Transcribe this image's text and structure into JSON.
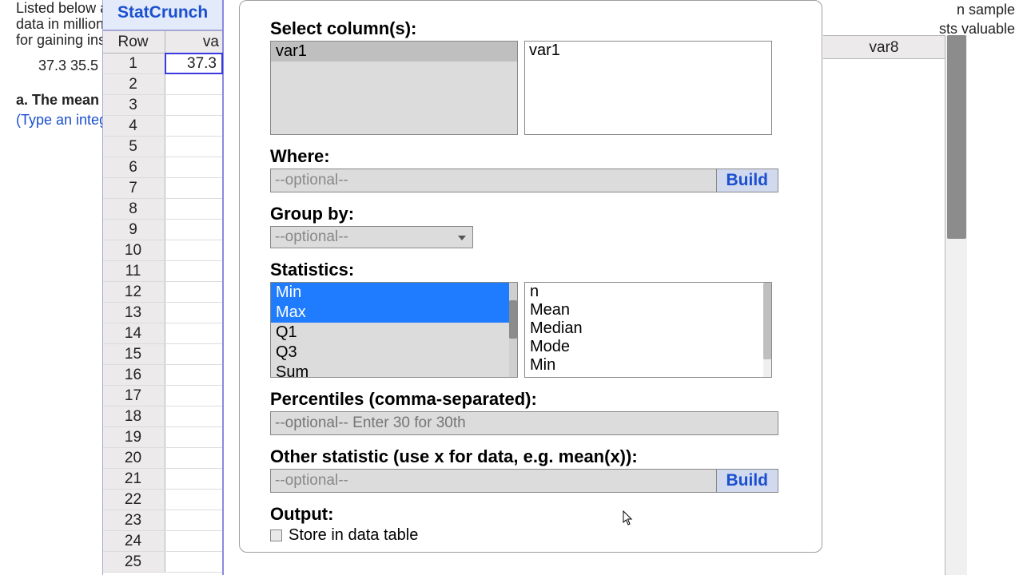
{
  "bg": {
    "tl_line1": "Listed below a",
    "tl_line2": "data in millions",
    "tl_line3": "for gaining ins",
    "tl_nums": "37.3   35.5",
    "mean_line": "a. The mean is",
    "type_link": "(Type an integ",
    "tr_line1": "n sample",
    "tr_line2": "sts valuable"
  },
  "spreadsheet": {
    "app_name": "StatCrunch",
    "row_header": "Row",
    "col_header": "va",
    "selected_value": "37.3",
    "rows": [
      "1",
      "2",
      "3",
      "4",
      "5",
      "6",
      "7",
      "8",
      "9",
      "10",
      "11",
      "12",
      "13",
      "14",
      "15",
      "16",
      "17",
      "18",
      "19",
      "20",
      "21",
      "22",
      "23",
      "24",
      "25"
    ]
  },
  "right": {
    "col_label": "var8"
  },
  "dialog": {
    "select_label": "Select column(s):",
    "avail_items": [
      "var1"
    ],
    "chosen_items": [
      "var1"
    ],
    "where_label": "Where:",
    "where_placeholder": "--optional--",
    "build_label": "Build",
    "groupby_label": "Group by:",
    "groupby_value": "--optional--",
    "stats_label": "Statistics:",
    "stats_left": [
      "Min",
      "Max",
      "Q1",
      "Q3",
      "Sum"
    ],
    "stats_left_selected": [
      "Min",
      "Max"
    ],
    "stats_right": [
      "n",
      "Mean",
      "Median",
      "Mode",
      "Min"
    ],
    "percentile_label": "Percentiles (comma-separated):",
    "percentile_placeholder": "--optional-- Enter 30 for 30th",
    "other_label": "Other statistic (use x for data, e.g. mean(x)):",
    "other_placeholder": "--optional--",
    "output_label": "Output:",
    "output_checkbox": "Store in data table"
  }
}
